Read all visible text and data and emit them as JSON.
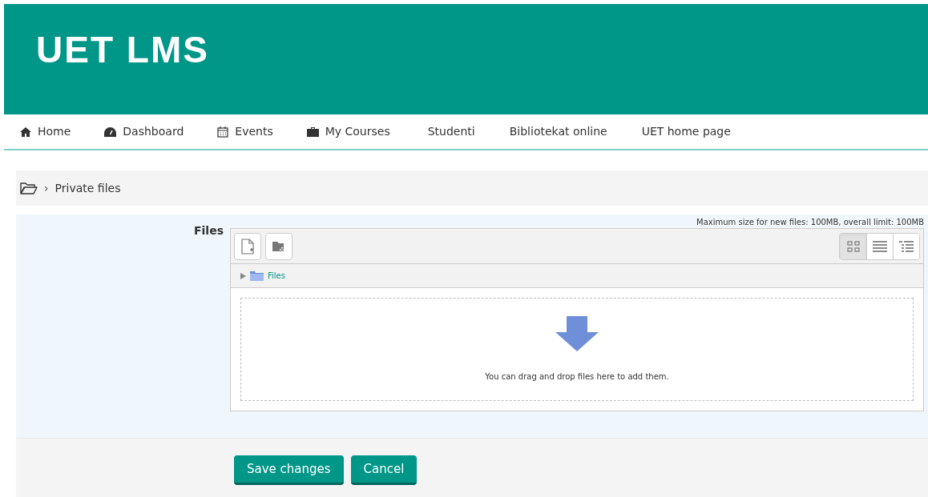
{
  "site_title": "UET LMS",
  "nav": [
    {
      "label": "Home"
    },
    {
      "label": "Dashboard"
    },
    {
      "label": "Events"
    },
    {
      "label": "My Courses"
    },
    {
      "label": "Studenti"
    },
    {
      "label": "Bibliotekat online"
    },
    {
      "label": "UET home page"
    }
  ],
  "breadcrumb": {
    "separator": "›",
    "current": "Private files"
  },
  "form": {
    "label": "Files",
    "limit_note": "Maximum size for new files: 100MB, overall limit: 100MB",
    "view_modes": [
      {
        "selected": true
      },
      {
        "selected": false
      },
      {
        "selected": false
      }
    ],
    "path": {
      "expanded": false,
      "label": "Files"
    },
    "drop_hint": "You can drag and drop files here to add them."
  },
  "buttons": [
    "Save changes",
    "Cancel"
  ]
}
